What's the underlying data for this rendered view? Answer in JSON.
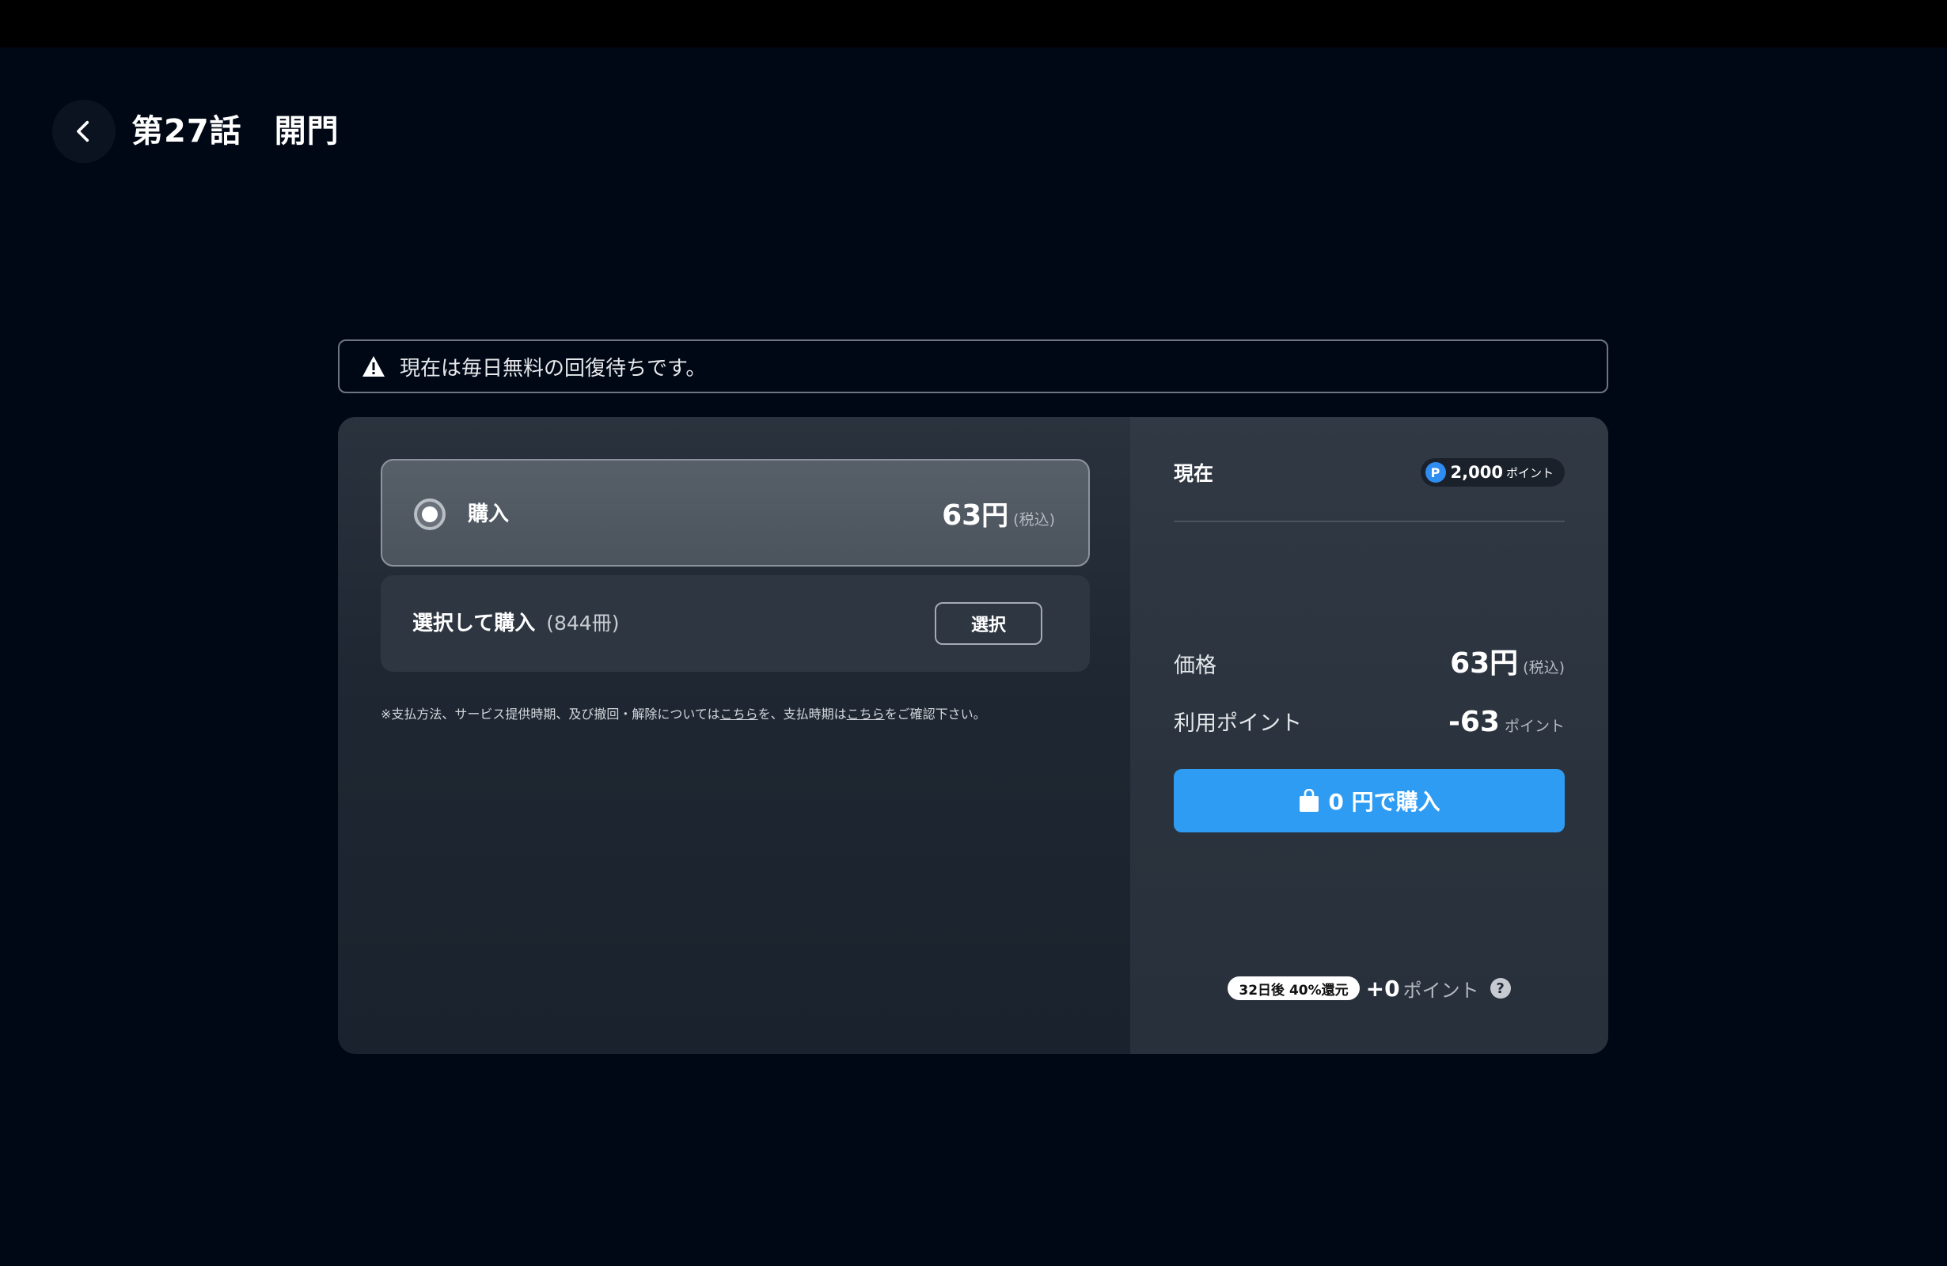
{
  "header": {
    "title": "第27話　開門",
    "back_icon": "chevron-left-icon"
  },
  "alert": {
    "icon": "warning-icon",
    "text": "現在は毎日無料の回復待ちです。"
  },
  "options": {
    "purchase": {
      "label": "購入",
      "price": "63",
      "unit": "円",
      "tax": "(税込)",
      "selected": true
    },
    "select_purchase": {
      "label": "選択して購入",
      "count": "(844冊)",
      "button_label": "選択"
    }
  },
  "footnote": {
    "part1": "※支払方法、サービス提供時期、及び撤回・解除については",
    "link1": "こちら",
    "part2": "を、支払時期は",
    "link2": "こちら",
    "part3": "をご確認下さい。"
  },
  "summary": {
    "current_label": "現在",
    "points_icon": "P",
    "points_value": "2,000",
    "points_unit": "ポイント",
    "price_label": "価格",
    "price_value": "63円",
    "price_tax": "(税込)",
    "use_points_label": "利用ポイント",
    "use_points_value": "-63",
    "use_points_unit": "ポイント",
    "buy_button_label": "0 円で購入",
    "buy_icon": "shopping-bag-icon",
    "reward_pill": "32日後 40%還元",
    "reward_value": "+0",
    "reward_unit": "ポイント",
    "help_icon": "?"
  },
  "colors": {
    "background": "#010815",
    "panel": "#1f2732",
    "accent": "#2f9cf4"
  }
}
